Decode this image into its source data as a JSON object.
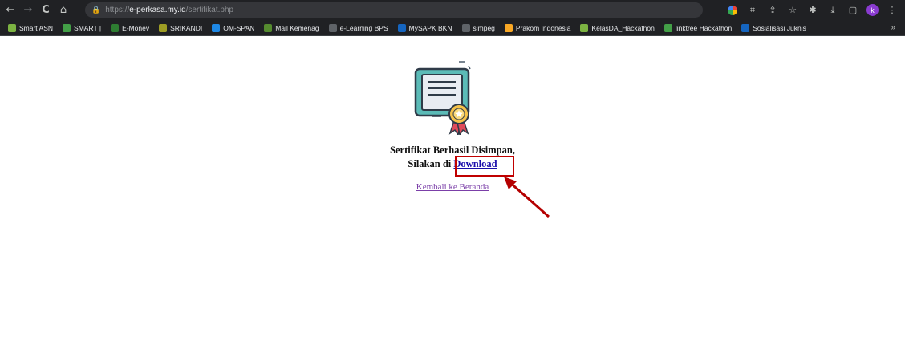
{
  "browser": {
    "url_scheme": "https://",
    "url_host": "e-perkasa.my.id",
    "url_path": "/sertifikat.php",
    "profile_initial": "k",
    "nav": {
      "back": "←",
      "forward": "→",
      "reload": "C",
      "home": "⌂"
    }
  },
  "bookmarks": [
    {
      "label": "Smart ASN",
      "color": "#7cb342"
    },
    {
      "label": "SMART |",
      "color": "#43a047"
    },
    {
      "label": "E-Monev",
      "color": "#2e7d32"
    },
    {
      "label": "SRIKANDI",
      "color": "#9e9d24"
    },
    {
      "label": "OM-SPAN",
      "color": "#1e88e5"
    },
    {
      "label": "Mail Kemenag",
      "color": "#558b2f"
    },
    {
      "label": "e-Learning BPS",
      "color": "#5f6368"
    },
    {
      "label": "MySAPK BKN",
      "color": "#1565c0"
    },
    {
      "label": "simpeg",
      "color": "#5f6368"
    },
    {
      "label": "Prakom Indonesia",
      "color": "#f9a825"
    },
    {
      "label": "KelasDA_Hackathon",
      "color": "#7cb342"
    },
    {
      "label": "linktree Hackathon",
      "color": "#43a047"
    },
    {
      "label": "Sosialisasi Juknis",
      "color": "#1565c0"
    }
  ],
  "bookmarks_more": "»",
  "page": {
    "line1": "Sertifikat Berhasil Disimpan,",
    "line2_prefix": "Silakan di ",
    "download_label": "Download",
    "home_link": "Kembali ke Beranda"
  },
  "colors": {
    "highlight": "#c00000",
    "link": "#1a0dab",
    "visited_link": "#7b3fa8"
  }
}
